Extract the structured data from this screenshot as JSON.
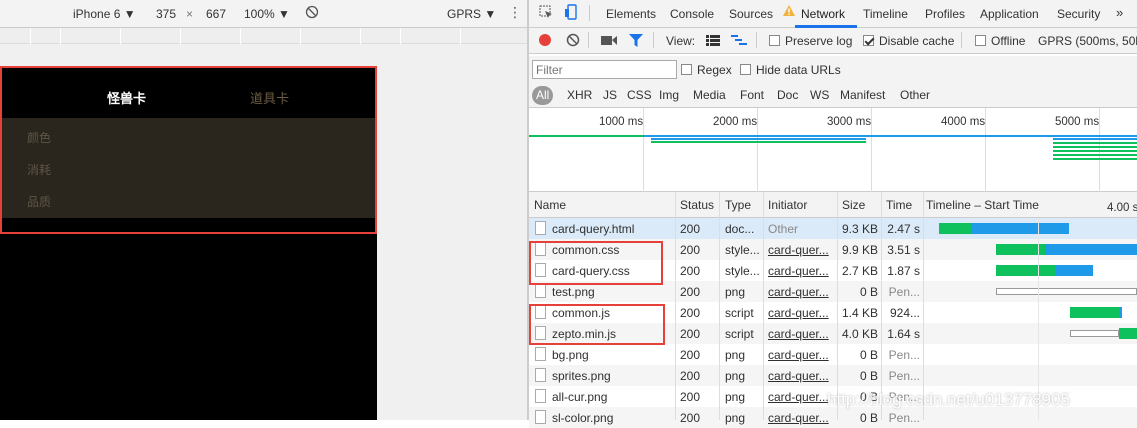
{
  "device_toolbar": {
    "device": "iPhone 6",
    "width": "375",
    "times": "×",
    "height": "667",
    "zoom": "100%",
    "network": "GPRS"
  },
  "app": {
    "tabs": [
      {
        "label": "怪兽卡",
        "color": "#ffffff"
      },
      {
        "label": "道具卡",
        "color": "#6b5c44"
      }
    ],
    "filters": [
      {
        "label": "颜色"
      },
      {
        "label": "消耗"
      },
      {
        "label": "品质"
      }
    ]
  },
  "devtools": {
    "tabs": [
      "Elements",
      "Console",
      "Sources",
      "Network",
      "Timeline",
      "Profiles",
      "Application",
      "Security"
    ],
    "active_tab": "Network"
  },
  "network_toolbar": {
    "view_label": "View:",
    "preserve_log": "Preserve log",
    "disable_cache": "Disable cache",
    "offline": "Offline",
    "throttle": "GPRS (500ms, 50kb"
  },
  "filter": {
    "placeholder": "Filter",
    "regex": "Regex",
    "hide_data_urls": "Hide data URLs"
  },
  "types": [
    "All",
    "XHR",
    "JS",
    "CSS",
    "Img",
    "Media",
    "Font",
    "Doc",
    "WS",
    "Manifest",
    "Other"
  ],
  "overview": {
    "ticks": [
      "1000 ms",
      "2000 ms",
      "3000 ms",
      "4000 ms",
      "5000 ms"
    ]
  },
  "columns": {
    "name": "Name",
    "status": "Status",
    "type": "Type",
    "initiator": "Initiator",
    "size": "Size",
    "time": "Time",
    "timeline": "Timeline – Start Time",
    "timeline_tick": "4.00 s"
  },
  "requests": [
    {
      "name": "card-query.html",
      "status": "200",
      "type": "doc...",
      "initiator": "Other",
      "size": "9.3 KB",
      "time": "2.47 s"
    },
    {
      "name": "common.css",
      "status": "200",
      "type": "style...",
      "initiator": "card-quer...",
      "size": "9.9 KB",
      "time": "3.51 s"
    },
    {
      "name": "card-query.css",
      "status": "200",
      "type": "style...",
      "initiator": "card-quer...",
      "size": "2.7 KB",
      "time": "1.87 s"
    },
    {
      "name": "test.png",
      "status": "200",
      "type": "png",
      "initiator": "card-quer...",
      "size": "0 B",
      "time": "Pen..."
    },
    {
      "name": "common.js",
      "status": "200",
      "type": "script",
      "initiator": "card-quer...",
      "size": "1.4 KB",
      "time": "924..."
    },
    {
      "name": "zepto.min.js",
      "status": "200",
      "type": "script",
      "initiator": "card-quer...",
      "size": "4.0 KB",
      "time": "1.64 s"
    },
    {
      "name": "bg.png",
      "status": "200",
      "type": "png",
      "initiator": "card-quer...",
      "size": "0 B",
      "time": "Pen..."
    },
    {
      "name": "sprites.png",
      "status": "200",
      "type": "png",
      "initiator": "card-quer...",
      "size": "0 B",
      "time": "Pen..."
    },
    {
      "name": "all-cur.png",
      "status": "200",
      "type": "png",
      "initiator": "card-quer...",
      "size": "0 B",
      "time": "Pen..."
    },
    {
      "name": "sl-color.png",
      "status": "200",
      "type": "png",
      "initiator": "card-quer...",
      "size": "0 B",
      "time": "Pen..."
    }
  ],
  "watermark": "http://blog.csdn.net/u013778905",
  "colors": {
    "waiting": "#0fc15c",
    "download": "#1f9ae8",
    "highlight": "#e5403a"
  }
}
